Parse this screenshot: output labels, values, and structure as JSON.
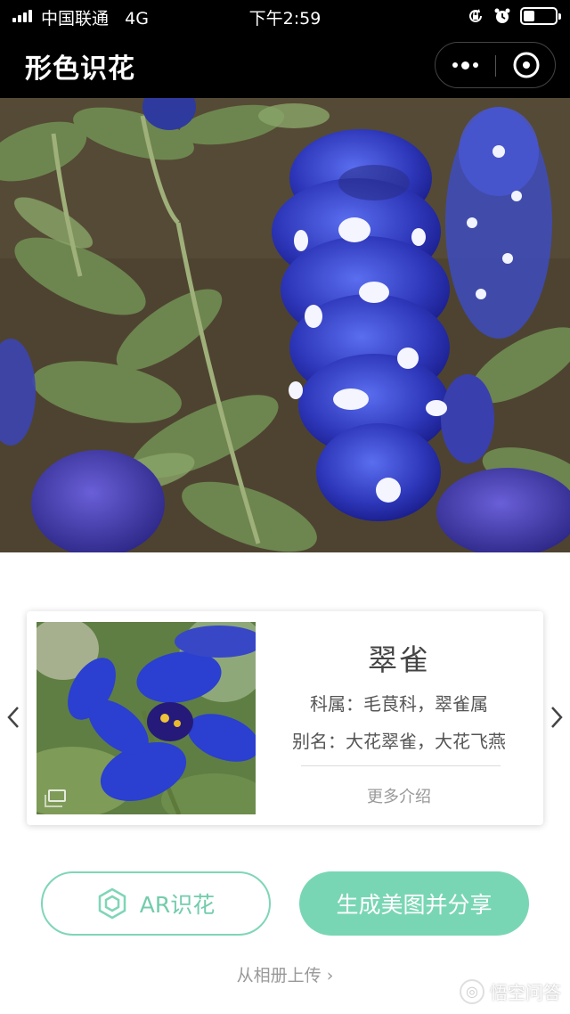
{
  "status_bar": {
    "carrier": "中国联通",
    "network": "4G",
    "time": "下午2:59",
    "battery_level": 0.35
  },
  "nav": {
    "title": "形色识花",
    "more_icon": "more-dots-icon",
    "close_icon": "close-target-icon"
  },
  "result": {
    "name": "翠雀",
    "family_text": "科属：毛茛科，翠雀属",
    "alias_text": "别名：大花翠雀，大花飞燕",
    "more_label": "更多介绍",
    "prev_icon": "chevron-left-icon",
    "next_icon": "chevron-right-icon"
  },
  "actions": {
    "ar_label": "AR识花",
    "share_label": "生成美图并分享",
    "upload_label": "从相册上传 ›"
  },
  "watermark": {
    "text": "悟空问答"
  },
  "colors": {
    "accent": "#79d6b4",
    "nav_bg": "#000000",
    "flower_blue": "#3a45c8"
  }
}
